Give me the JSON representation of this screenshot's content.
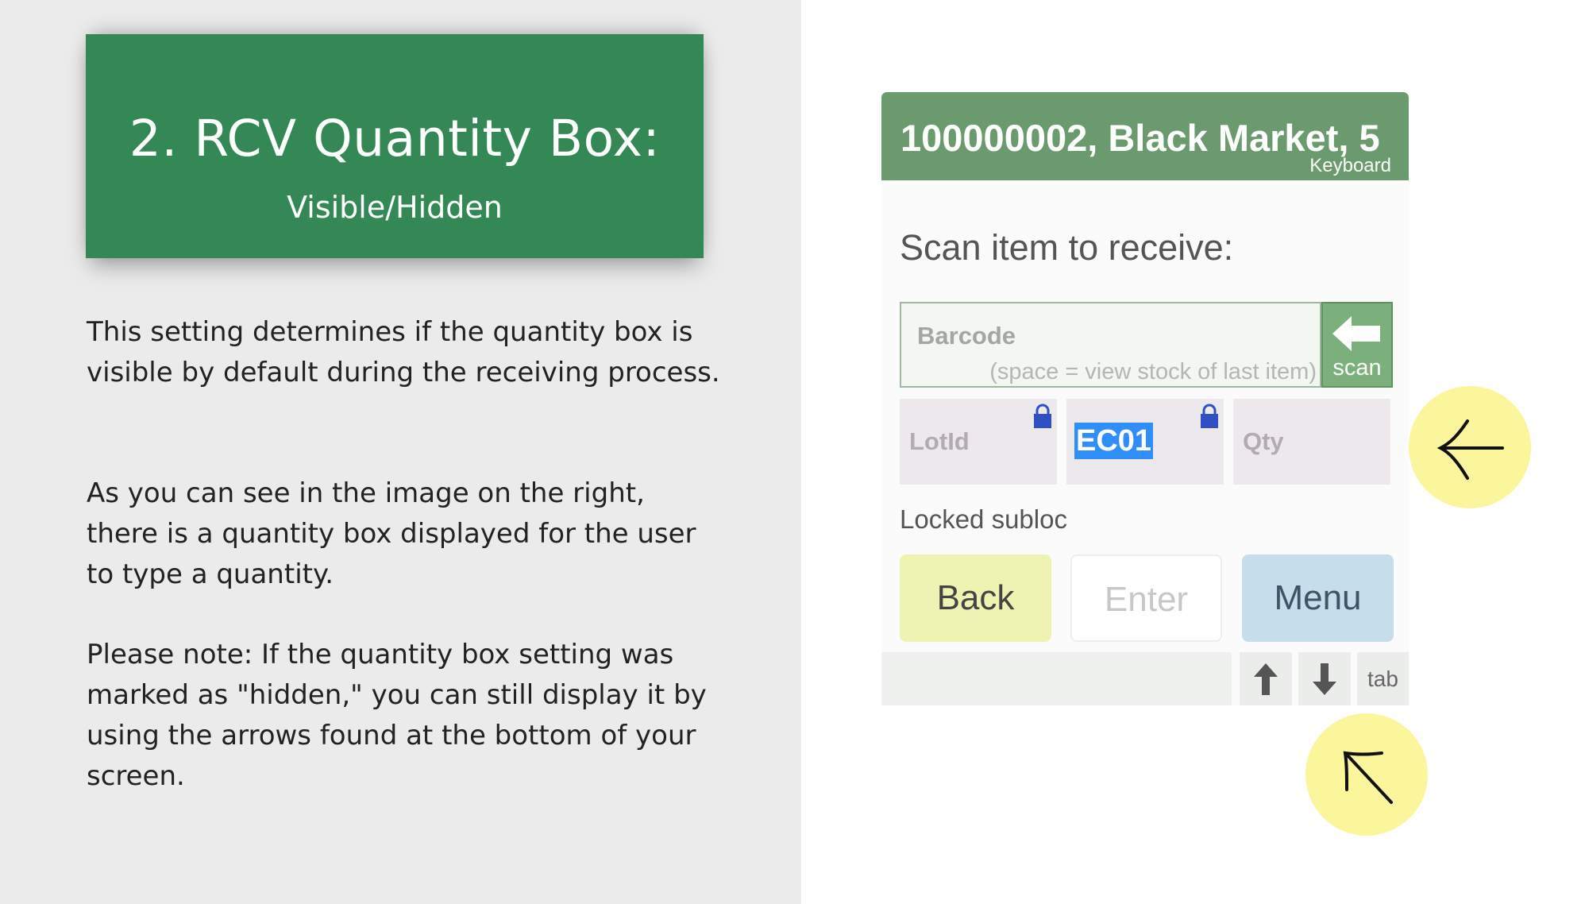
{
  "slide": {
    "title": "2. RCV Quantity Box:",
    "subtitle": "Visible/Hidden",
    "paragraphs": [
      "This setting determines if the quantity box is visible by default during the receiving process.",
      "As you can see in the image on the right, there is a quantity box displayed for the user to type a quantity.",
      "Please note: If the quantity box setting was marked as \"hidden,\" you can still display it by using the arrows found at the bottom of your screen."
    ]
  },
  "device": {
    "header_title": "100000002, Black Market, 5",
    "keyboard_label": "Keyboard",
    "prompt": "Scan item to receive:",
    "barcode": {
      "label": "Barcode",
      "hint": "(space = view stock of last item)"
    },
    "scan_label": "scan",
    "fields": {
      "lotid_label": "LotId",
      "subloc_value": "EC01",
      "qty_label": "Qty"
    },
    "locked_note": "Locked subloc",
    "buttons": {
      "back": "Back",
      "enter": "Enter",
      "menu": "Menu",
      "tab": "tab"
    }
  },
  "icons": {
    "scan": "left-arrow-icon",
    "locks": "lock-icon",
    "nav_up": "arrow-up-icon",
    "nav_down": "arrow-down-icon",
    "marker_1": "left-arrow-icon",
    "marker_2": "up-left-arrow-icon"
  },
  "colors": {
    "title_box": "#348856",
    "left_panel": "#ebebeb",
    "device_header": "#6a9a6e",
    "scan_button": "#7bb07c",
    "back_button": "#eff3b1",
    "menu_button": "#c6ddeb",
    "selection": "#2f8ef7",
    "lock": "#2f4fc4",
    "marker": "#fbf59b"
  }
}
